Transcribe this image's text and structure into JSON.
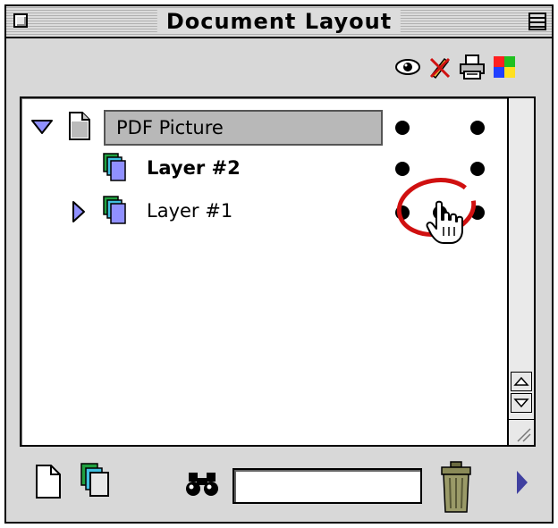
{
  "window": {
    "title": "Document Layout"
  },
  "toolbar_icons": [
    "eye-icon",
    "no-edit-pencil-icon",
    "printer-icon",
    "color-swatch-icon"
  ],
  "layers": [
    {
      "label": "PDF Picture",
      "expanded": true,
      "selected": true,
      "bold": false,
      "icon": "document-icon"
    },
    {
      "label": "Layer #2",
      "expanded": false,
      "selected": false,
      "bold": true,
      "icon": "layers-icon"
    },
    {
      "label": "Layer #1",
      "expanded": false,
      "selected": false,
      "bold": false,
      "icon": "layers-icon"
    }
  ],
  "bottom_bar": {
    "search_value": "",
    "icons": [
      "new-page-icon",
      "new-layer-icon",
      "find-binoculars-icon",
      "trash-icon",
      "disclosure-arrow-icon"
    ]
  },
  "colors": {
    "window_bg": "#d8d8d8",
    "selection": "#b8b8b8",
    "disclosure_triangle": "#7070ff",
    "annotation_circle": "#d01010"
  }
}
